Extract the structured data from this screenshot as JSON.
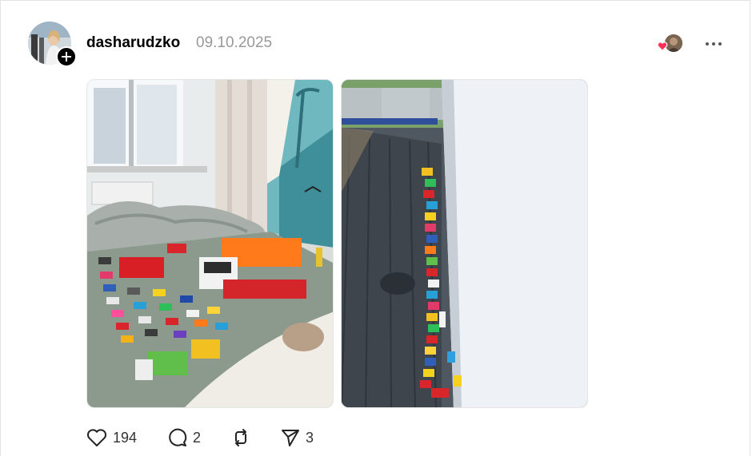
{
  "post": {
    "author": {
      "username": "dasharudzko"
    },
    "date": "09.10.2025",
    "photos": [
      {
        "icon": "photo-toys-bedroom"
      },
      {
        "icon": "photo-toys-terrace"
      }
    ],
    "actions": {
      "like_count": "194",
      "comment_count": "2",
      "share_count": "3"
    }
  },
  "colors": {
    "heart": "#ff2f55",
    "date": "#999999"
  }
}
